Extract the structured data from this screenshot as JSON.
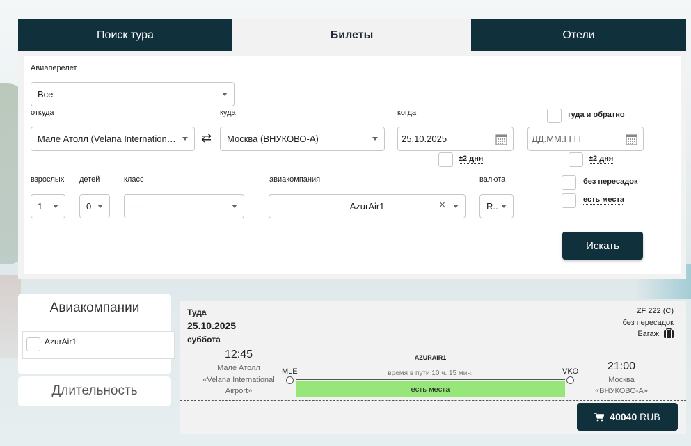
{
  "tabs": [
    {
      "label": "Поиск тура"
    },
    {
      "label": "Билеты"
    },
    {
      "label": "Отели"
    }
  ],
  "form": {
    "flight_label": "Авиаперелет",
    "flight_value": "Все",
    "from_label": "откуда",
    "from_value": "Мале Атолл (Velana International Airport)",
    "to_label": "куда",
    "to_value": "Москва (ВНУКОВО-А)",
    "when_label": "когда",
    "when_value": "25.10.2025",
    "return_placeholder": "ДД.ММ.ГГГГ",
    "roundtrip_label": "туда и обратно",
    "flex1_label": "±2 дня",
    "flex2_label": "±2 дня",
    "adults_label": "взрослых",
    "adults_value": "1",
    "children_label": "детей",
    "children_value": "0",
    "class_label": "класс",
    "class_value": "----",
    "airline_label": "авиакомпания",
    "airline_value": "AzurAir1",
    "currency_label": "валюта",
    "currency_value": "R..",
    "nonstop_label": "без пересадок",
    "seats_label": "есть места",
    "search_label": "Искать"
  },
  "filters": {
    "airlines_title": "Авиакомпании",
    "airline_option": "AzurAir1",
    "duration_title": "Длительность"
  },
  "result": {
    "direction": "Туда",
    "date": "25.10.2025",
    "weekday": "суббота",
    "flight_number": "ZF 222 (C)",
    "stops": "без пересадок",
    "baggage_label": "Багаж:",
    "dep_time": "12:45",
    "dep_city": "Мале Атолл",
    "dep_airport_1": "«Velana International",
    "dep_airport_2": "Airport»",
    "dep_code": "MLE",
    "airline": "AZURAIR1",
    "duration": "время в пути 10 ч. 15 мин.",
    "availability": "есть места",
    "arr_code": "VKO",
    "arr_time": "21:00",
    "arr_city": "Москва",
    "arr_airport": "«ВНУКОВО-А»",
    "price": "40040",
    "currency": "RUB"
  },
  "colors": {
    "brand_dark": "#10303c",
    "availability_green": "#96e67a"
  }
}
